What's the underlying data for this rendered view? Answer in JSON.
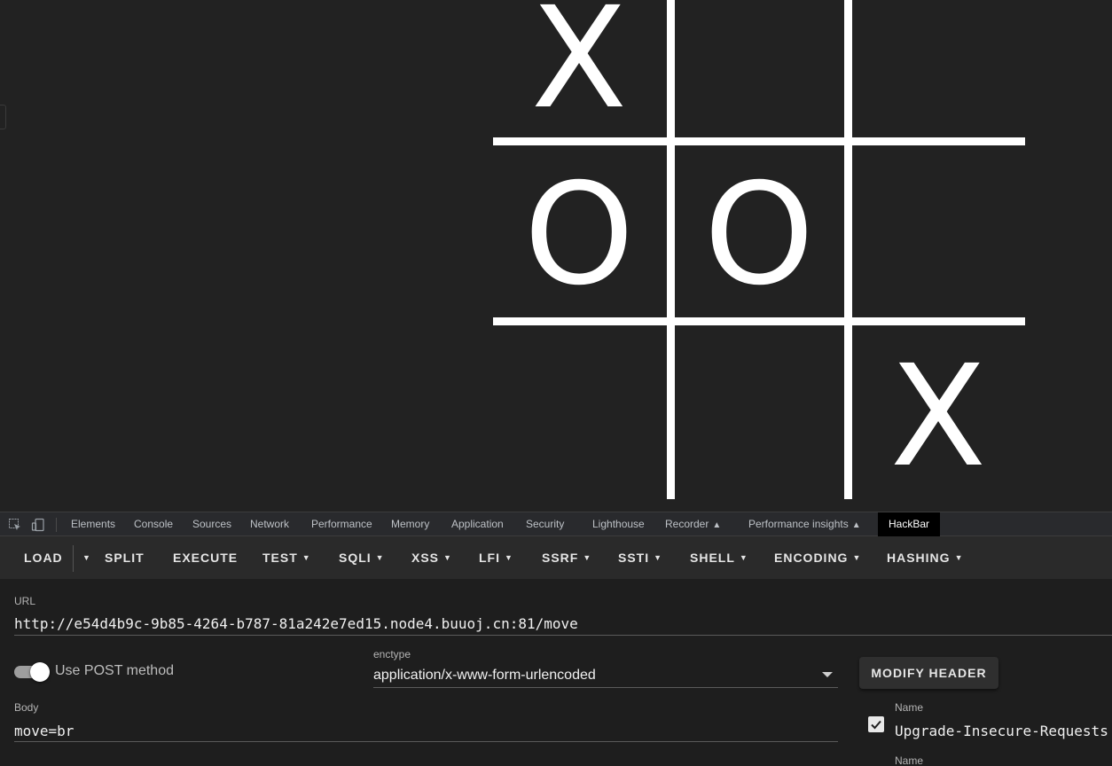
{
  "game": {
    "board": [
      "X",
      "",
      "",
      "O",
      "O",
      "",
      "",
      "",
      "X"
    ]
  },
  "devtools": {
    "tabs": [
      "Elements",
      "Console",
      "Sources",
      "Network",
      "Performance",
      "Memory",
      "Application",
      "Security",
      "Lighthouse",
      "Recorder",
      "Performance insights",
      "HackBar"
    ],
    "active_tab": "HackBar",
    "icons": [
      "inspect-element-icon",
      "device-toolbar-icon",
      "flask-icon"
    ]
  },
  "hackbar": {
    "buttons": [
      "LOAD",
      "SPLIT",
      "EXECUTE",
      "TEST",
      "SQLI",
      "XSS",
      "LFI",
      "SSRF",
      "SSTI",
      "SHELL",
      "ENCODING",
      "HASHING"
    ],
    "url_label": "URL",
    "url_value": "http://e54d4b9c-9b85-4264-b787-81a242e7ed15.node4.buuoj.cn:81/move",
    "post_method_label": "Use POST method",
    "post_method_enabled": true,
    "enctype_label": "enctype",
    "enctype_value": "application/x-www-form-urlencoded",
    "modify_header_label": "MODIFY HEADER",
    "body_label": "Body",
    "body_value": "move=br",
    "headers": [
      {
        "name_label": "Name",
        "value": "Upgrade-Insecure-Requests",
        "checked": true
      },
      {
        "name_label": "Name",
        "value": ""
      }
    ]
  }
}
